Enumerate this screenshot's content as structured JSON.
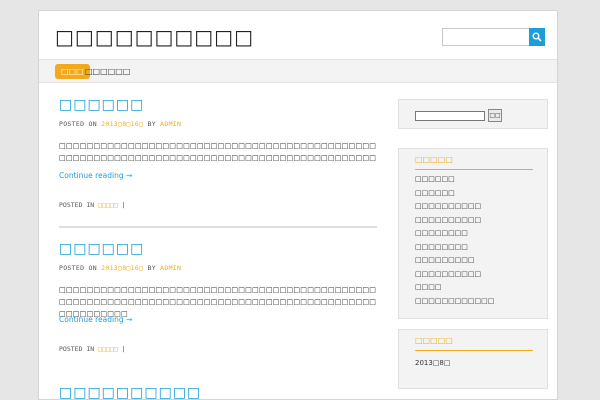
{
  "site": {
    "title": "□□□□□□□□□□"
  },
  "header_search": {
    "placeholder": "",
    "value": ""
  },
  "nav": [
    {
      "label": "□□□",
      "active": true
    },
    {
      "label": "□□□□□□"
    }
  ],
  "posts": [
    {
      "title": "□□□□□□",
      "meta": {
        "posted_on": "POSTED ON",
        "date": "2013□8□16□",
        "by": "BY",
        "author": "ADMIN"
      },
      "excerpt": "□□□□□□□□□□□□□□□□□□□□□□□□□□□□□□□□□□□□□□□□□□□□□□□□□□□□□□□□□□□□□□□□□□□□□□□□□□□□□□□□□□□□□□□□□□□□",
      "continue_label": "Continue reading →",
      "footer": {
        "posted_in": "POSTED IN",
        "category": "□□□□□",
        "sep": "|"
      }
    },
    {
      "title": "□□□□□□",
      "meta": {
        "posted_on": "POSTED ON",
        "date": "2013□8□16□",
        "by": "BY",
        "author": "ADMIN"
      },
      "excerpt": "□□□□□□□□□□□□□□□□□□□□□□□□□□□□□□□□□□□□□□□□□□□□□□□□□□□□□□□□□□□□□□□□□□□□□□□□□□□□□□□□□□□□□□□□□□□□□□□□□□□□□□",
      "continue_label": "Continue reading →",
      "footer": {
        "posted_in": "POSTED IN",
        "category": "□□□□□",
        "sep": "|"
      }
    },
    {
      "title": "□□□□□□□□□□"
    }
  ],
  "sidebar": {
    "search": {
      "button_label": "□□"
    },
    "recent": {
      "title": "□□□□□",
      "items": [
        "□□□□□□",
        "□□□□□□",
        "□□□□□□□□□□",
        "□□□□□□□□□□",
        "□□□□□□□□",
        "□□□□□□□□",
        "□□□□□□□□□",
        "□□□□□□□□□□",
        "□□□□",
        "□□□□□□□□□□□□"
      ]
    },
    "archives": {
      "title": "□□□□□",
      "items": [
        "2013□8□"
      ]
    }
  },
  "colors": {
    "accent": "#1d9fd8",
    "highlight": "#f2a91a",
    "background": "#e6e6e6"
  }
}
